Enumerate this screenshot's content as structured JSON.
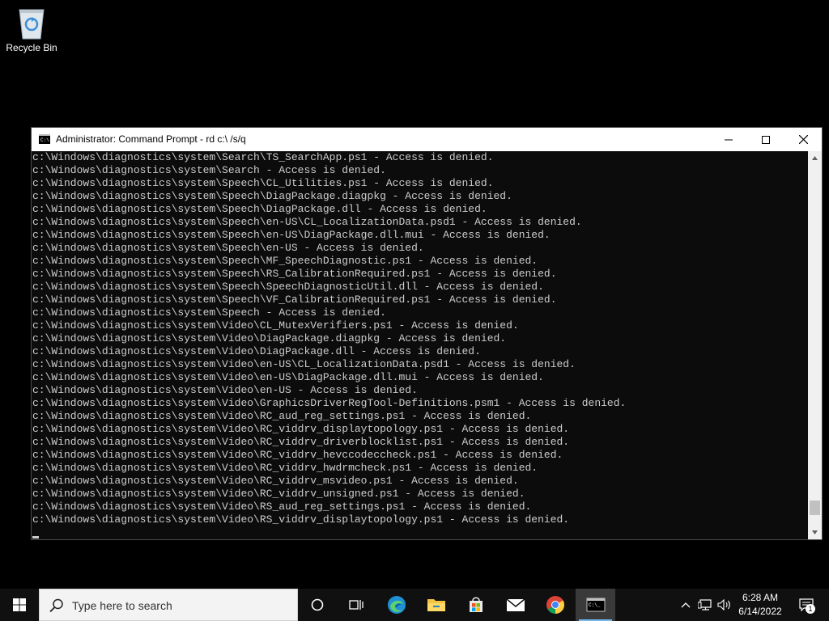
{
  "desktop": {
    "icons": [
      {
        "label": "Recycle Bin",
        "icon": "recycle-bin-icon"
      }
    ]
  },
  "window": {
    "title": "Administrator: Command Prompt - rd  c:\\ /s/q",
    "app_icon": "cmd-icon",
    "console_lines": [
      "c:\\Windows\\diagnostics\\system\\Search\\TS_SearchApp.ps1 - Access is denied.",
      "c:\\Windows\\diagnostics\\system\\Search - Access is denied.",
      "c:\\Windows\\diagnostics\\system\\Speech\\CL_Utilities.ps1 - Access is denied.",
      "c:\\Windows\\diagnostics\\system\\Speech\\DiagPackage.diagpkg - Access is denied.",
      "c:\\Windows\\diagnostics\\system\\Speech\\DiagPackage.dll - Access is denied.",
      "c:\\Windows\\diagnostics\\system\\Speech\\en-US\\CL_LocalizationData.psd1 - Access is denied.",
      "c:\\Windows\\diagnostics\\system\\Speech\\en-US\\DiagPackage.dll.mui - Access is denied.",
      "c:\\Windows\\diagnostics\\system\\Speech\\en-US - Access is denied.",
      "c:\\Windows\\diagnostics\\system\\Speech\\MF_SpeechDiagnostic.ps1 - Access is denied.",
      "c:\\Windows\\diagnostics\\system\\Speech\\RS_CalibrationRequired.ps1 - Access is denied.",
      "c:\\Windows\\diagnostics\\system\\Speech\\SpeechDiagnosticUtil.dll - Access is denied.",
      "c:\\Windows\\diagnostics\\system\\Speech\\VF_CalibrationRequired.ps1 - Access is denied.",
      "c:\\Windows\\diagnostics\\system\\Speech - Access is denied.",
      "c:\\Windows\\diagnostics\\system\\Video\\CL_MutexVerifiers.ps1 - Access is denied.",
      "c:\\Windows\\diagnostics\\system\\Video\\DiagPackage.diagpkg - Access is denied.",
      "c:\\Windows\\diagnostics\\system\\Video\\DiagPackage.dll - Access is denied.",
      "c:\\Windows\\diagnostics\\system\\Video\\en-US\\CL_LocalizationData.psd1 - Access is denied.",
      "c:\\Windows\\diagnostics\\system\\Video\\en-US\\DiagPackage.dll.mui - Access is denied.",
      "c:\\Windows\\diagnostics\\system\\Video\\en-US - Access is denied.",
      "c:\\Windows\\diagnostics\\system\\Video\\GraphicsDriverRegTool-Definitions.psm1 - Access is denied.",
      "c:\\Windows\\diagnostics\\system\\Video\\RC_aud_reg_settings.ps1 - Access is denied.",
      "c:\\Windows\\diagnostics\\system\\Video\\RC_viddrv_displaytopology.ps1 - Access is denied.",
      "c:\\Windows\\diagnostics\\system\\Video\\RC_viddrv_driverblocklist.ps1 - Access is denied.",
      "c:\\Windows\\diagnostics\\system\\Video\\RC_viddrv_hevccodeccheck.ps1 - Access is denied.",
      "c:\\Windows\\diagnostics\\system\\Video\\RC_viddrv_hwdrmcheck.ps1 - Access is denied.",
      "c:\\Windows\\diagnostics\\system\\Video\\RC_viddrv_msvideo.ps1 - Access is denied.",
      "c:\\Windows\\diagnostics\\system\\Video\\RC_viddrv_unsigned.ps1 - Access is denied.",
      "c:\\Windows\\diagnostics\\system\\Video\\RS_aud_reg_settings.ps1 - Access is denied.",
      "c:\\Windows\\diagnostics\\system\\Video\\RS_viddrv_displaytopology.ps1 - Access is denied."
    ],
    "scroll_position": 0.97
  },
  "taskbar": {
    "search_placeholder": "Type here to search",
    "apps": [
      "cortana-icon",
      "task-view-icon",
      "edge-icon",
      "file-explorer-icon",
      "store-icon",
      "mail-icon",
      "chrome-icon",
      "cmd-icon"
    ],
    "active_app": "cmd-icon",
    "tray_icons": [
      "chevron-up-icon",
      "network-icon",
      "volume-icon"
    ],
    "time": "6:28 AM",
    "date": "6/14/2022",
    "notification_count": "1"
  },
  "colors": {
    "console_bg": "#0c0c0c",
    "console_text": "#cccccc",
    "taskbar_bg": "#101010",
    "desktop_bg": "#000000"
  }
}
